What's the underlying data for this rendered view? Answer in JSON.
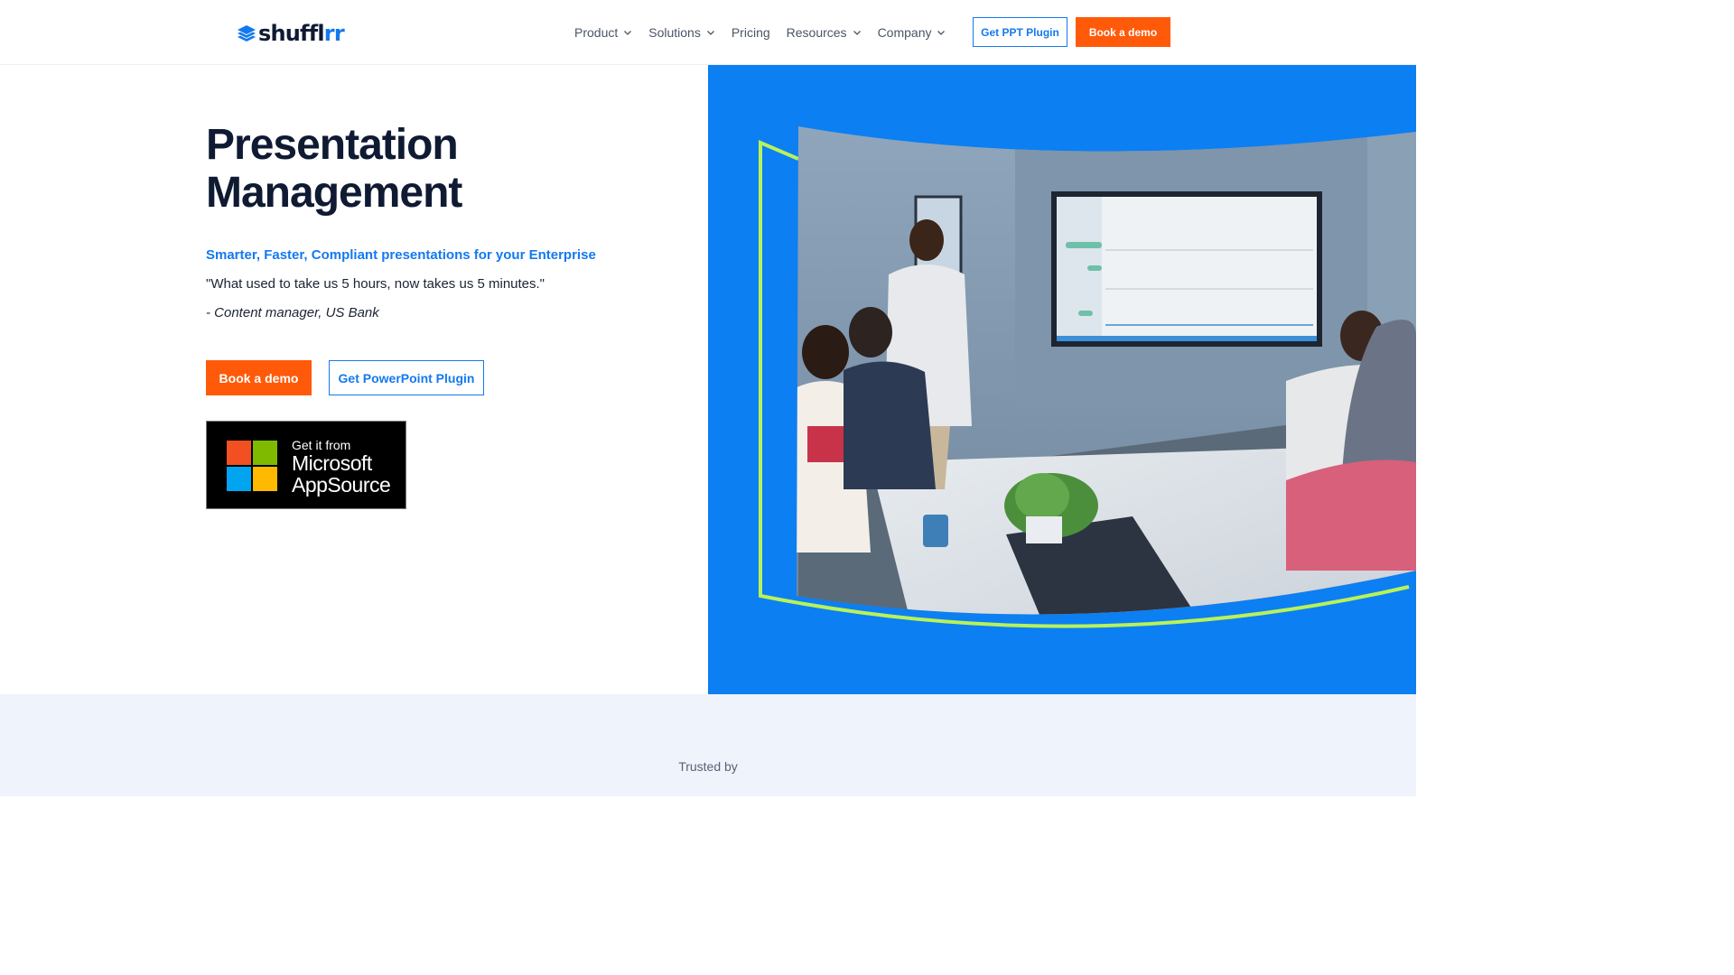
{
  "header": {
    "logo": {
      "text_main": "shuffl",
      "text_accent": "rr",
      "icon": "stacked-layers-icon"
    },
    "nav": [
      {
        "label": "Product",
        "has_dropdown": true
      },
      {
        "label": "Solutions",
        "has_dropdown": true
      },
      {
        "label": "Pricing",
        "has_dropdown": false
      },
      {
        "label": "Resources",
        "has_dropdown": true
      },
      {
        "label": "Company",
        "has_dropdown": true
      }
    ],
    "plugin_button": "Get PPT Plugin",
    "demo_button": "Book a demo"
  },
  "hero": {
    "title": "Presentation Management",
    "tagline": "Smarter, Faster, Compliant presentations for your Enterprise",
    "quote": "\"What used to take us 5 hours, now takes us 5 minutes.\"",
    "attribution": "- Content manager, US Bank",
    "primary_button": "Book a demo",
    "secondary_button": "Get PowerPoint Plugin",
    "badge": {
      "line1": "Get it from",
      "line2": "Microsoft",
      "line3": "AppSource"
    },
    "visual": {
      "description_icon": "meeting-room-photo",
      "background": "#0c7ff2",
      "frame_accent": "#b8f25a"
    }
  },
  "trusted": {
    "label": "Trusted by"
  },
  "colors": {
    "brand_blue": "#1479ef",
    "brand_orange": "#ff5a0a",
    "navy": "#0f1a33"
  }
}
